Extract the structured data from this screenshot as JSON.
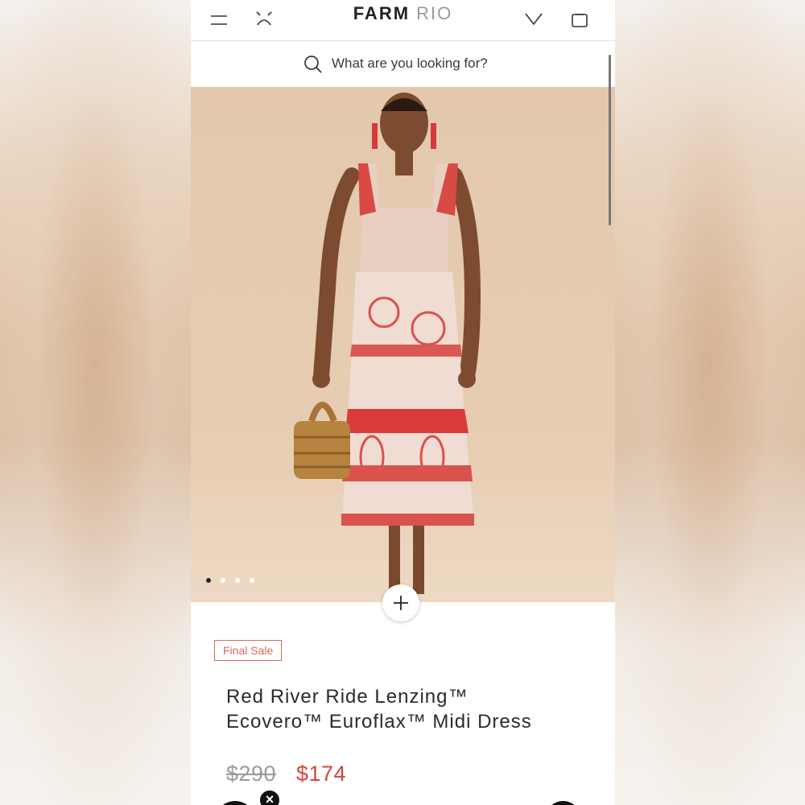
{
  "header": {
    "brand_part1": "FARM",
    "brand_part2": "RIO",
    "menu_icon": "hamburger-menu-icon",
    "account_icon": "account-icon",
    "wishlist_icon": "chevron-heart-icon",
    "bag_icon": "shopping-bag-icon"
  },
  "search": {
    "placeholder": "What are you looking for?",
    "icon": "search-icon"
  },
  "gallery": {
    "image_count": 4,
    "active_index": 0,
    "zoom_icon": "plus-icon"
  },
  "product": {
    "badge": "Final Sale",
    "title_line1": "Red River Ride Lenzing™",
    "title_line2": "Ecovero™ Euroflax™ Midi Dress",
    "price_original": "$290",
    "price_sale": "$174"
  },
  "colors": {
    "sale": "#d2483a",
    "badge": "#d9695a",
    "hero_bg": "#e2c8ac"
  }
}
